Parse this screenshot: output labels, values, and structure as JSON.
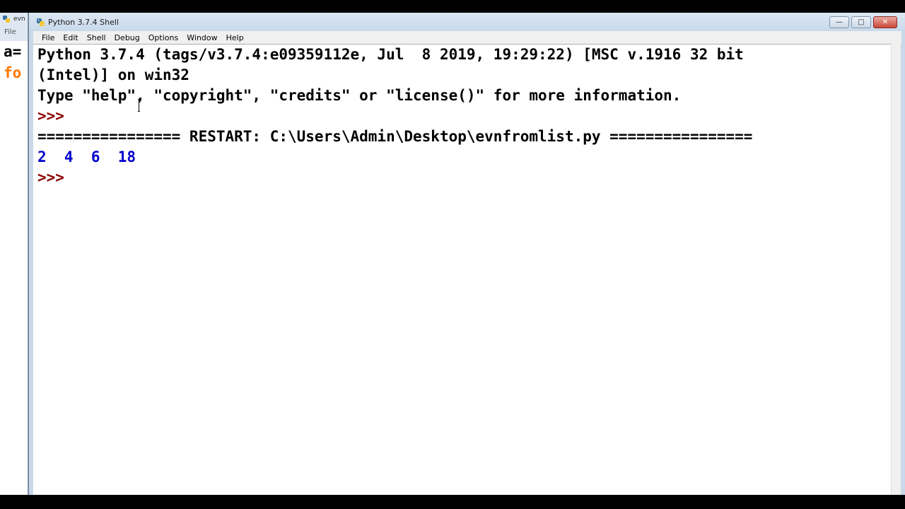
{
  "background_window": {
    "title": "evn",
    "menu_file": "File",
    "code_lines": [
      "a=",
      "fo"
    ]
  },
  "window": {
    "title": "Python 3.7.4 Shell",
    "icon": "python-icon",
    "controls": {
      "minimize": "—",
      "maximize": "□",
      "close": "✕"
    }
  },
  "menubar": {
    "items": [
      "File",
      "Edit",
      "Shell",
      "Debug",
      "Options",
      "Window",
      "Help"
    ]
  },
  "shell": {
    "banner_line1": "Python 3.7.4 (tags/v3.7.4:e09359112e, Jul  8 2019, 19:29:22) [MSC v.1916 32 bit",
    "banner_line2": "(Intel)] on win32",
    "banner_line3": "Type \"help\", \"copyright\", \"credits\" or \"license()\" for more information.",
    "prompt1": ">>> ",
    "restart_line": "================ RESTART: C:\\Users\\Admin\\Desktop\\evnfromlist.py ================",
    "output_line": "2  4  6  18",
    "prompt2": ">>> "
  },
  "colors": {
    "prompt": "#8b0000",
    "output": "#0000cc",
    "keyword_orange": "#ff7700"
  }
}
